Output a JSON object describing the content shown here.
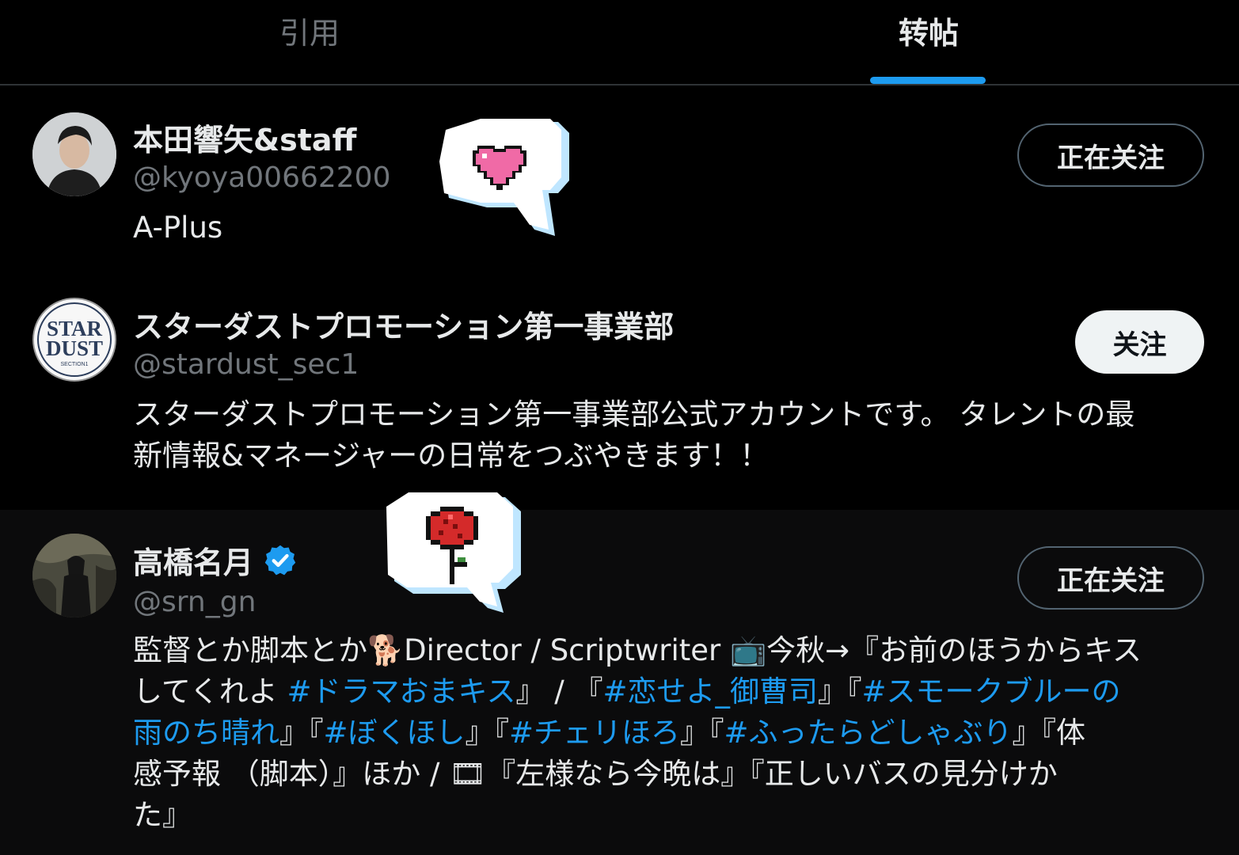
{
  "tabs": {
    "quote_label": "引用",
    "repost_label": "转帖",
    "active": "转帖"
  },
  "users": [
    {
      "name": "本田響矢&staff",
      "handle": "@kyoya00662200",
      "bio": "A-Plus",
      "button_label": "正在关注",
      "verified": false
    },
    {
      "name": "スターダストプロモーション第一事業部",
      "handle": "@stardust_sec1",
      "bio_line1": "スターダストプロモーション第一事業部公式アカウントです。 タレントの最",
      "bio_line2": "新情報&マネージャーの日常をつぶやきます！！",
      "button_label": "关注",
      "verified": false,
      "avatar_logo_line1": "STAR",
      "avatar_logo_line2": "DUST",
      "avatar_logo_line3": "SECTION1"
    },
    {
      "name": "高橋名月",
      "handle": "@srn_gn",
      "button_label": "正在关注",
      "verified": true,
      "bio": {
        "l1_text": "監督とか脚本とか",
        "l1_emoji": "🐕",
        "l1_text2": "Director / Scriptwriter ",
        "l1_emoji2": "📺",
        "l1_text3": "今秋→『お前のほうからキス",
        "l2_text": "してくれよ ",
        "l2_tag1": "#ドラマおまキス",
        "l2_text2": "』 / 『",
        "l2_tag2": "#恋せよ_御曹司",
        "l2_text3": "』『",
        "l2_tag3": "#スモークブルーの",
        "l3_tag3b": "雨のち晴れ",
        "l3_text": "』『",
        "l3_tag4": "#ぼくほし",
        "l3_text2": "』『",
        "l3_tag5": "#チェリほろ",
        "l3_text3": "』『",
        "l3_tag6": "#ふったらどしゃぶり",
        "l3_text4": "』『体",
        "l4_text": "感予報 （脚本）』ほか / ",
        "l4_emoji": "🎞",
        "l4_text2": "『左様なら今晩は』『正しいバスの見分けか",
        "l5_text": "た』"
      }
    }
  ],
  "stickers": {
    "first": "heart-speech-bubble",
    "second": "rose-speech-bubble"
  },
  "colors": {
    "accent": "#1d9bf0",
    "background": "#000000",
    "text_primary": "#e7e9ea",
    "text_secondary": "#71767b",
    "heart": "#f06aa6",
    "rose": "#d42a2a"
  }
}
